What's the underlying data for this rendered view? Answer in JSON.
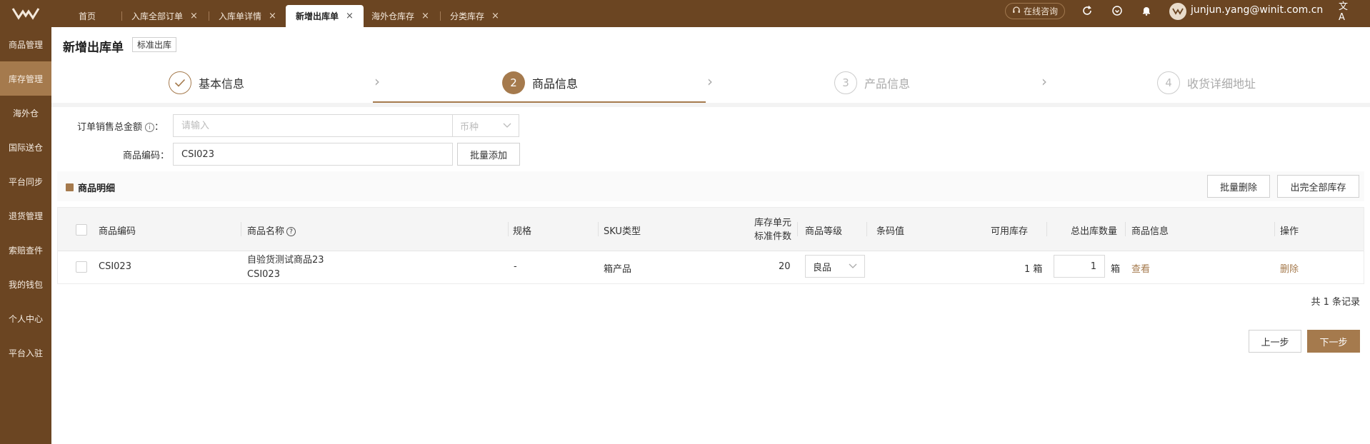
{
  "tabs": [
    {
      "label": "首页",
      "closable": false
    },
    {
      "label": "入库全部订单",
      "closable": true
    },
    {
      "label": "入库单详情",
      "closable": true
    },
    {
      "label": "新增出库单",
      "closable": true,
      "active": true
    },
    {
      "label": "海外仓库存",
      "closable": true
    },
    {
      "label": "分类库存",
      "closable": true
    }
  ],
  "header": {
    "consult_label": "在线咨询",
    "user_email": "junjun.yang@winit.com.cn"
  },
  "sidebar": {
    "items": [
      {
        "label": "商品管理"
      },
      {
        "label": "库存管理",
        "active": true
      },
      {
        "label": "海外仓"
      },
      {
        "label": "国际送仓"
      },
      {
        "label": "平台同步"
      },
      {
        "label": "退货管理"
      },
      {
        "label": "索赔查件"
      },
      {
        "label": "我的钱包"
      },
      {
        "label": "个人中心"
      },
      {
        "label": "平台入驻"
      }
    ]
  },
  "page": {
    "title": "新增出库单",
    "tag": "标准出库"
  },
  "steps": [
    {
      "index": "✓",
      "label": "基本信息",
      "state": "done"
    },
    {
      "index": "2",
      "label": "商品信息",
      "state": "current"
    },
    {
      "index": "3",
      "label": "产品信息",
      "state": "todo"
    },
    {
      "index": "4",
      "label": "收货详细地址",
      "state": "todo"
    }
  ],
  "form": {
    "amount_label": "订单销售总金额",
    "amount_suffix": "：",
    "amount_placeholder": "请输入",
    "currency_placeholder": "币种",
    "code_label": "商品编码：",
    "code_value": "CSI023",
    "bulk_add_label": "批量添加"
  },
  "section": {
    "title": "商品明细",
    "bulk_delete_label": "批量删除",
    "ship_all_label": "出完全部库存"
  },
  "table": {
    "headers": {
      "code": "商品编码",
      "name": "商品名称",
      "spec": "规格",
      "sku_type": "SKU类型",
      "unit_line1": "库存单元",
      "unit_line2": "标准件数",
      "grade": "商品等级",
      "barcode": "条码值",
      "available": "可用库存",
      "out_qty": "总出库数量",
      "info": "商品信息",
      "action": "操作"
    },
    "rows": [
      {
        "code": "CSI023",
        "name": "自验货测试商品23",
        "name_code": "CSI023",
        "spec": "-",
        "sku_type": "箱产品",
        "unit_count": "20",
        "grade": "良品",
        "barcode": "",
        "available": "1 箱",
        "out_qty": "1",
        "out_unit": "箱",
        "view_label": "查看",
        "delete_label": "删除"
      }
    ],
    "total": "共 1 条记录"
  },
  "footer": {
    "prev_label": "上一步",
    "next_label": "下一步"
  },
  "colors": {
    "brand_dark": "#6b4522",
    "accent": "#a57a4d"
  }
}
